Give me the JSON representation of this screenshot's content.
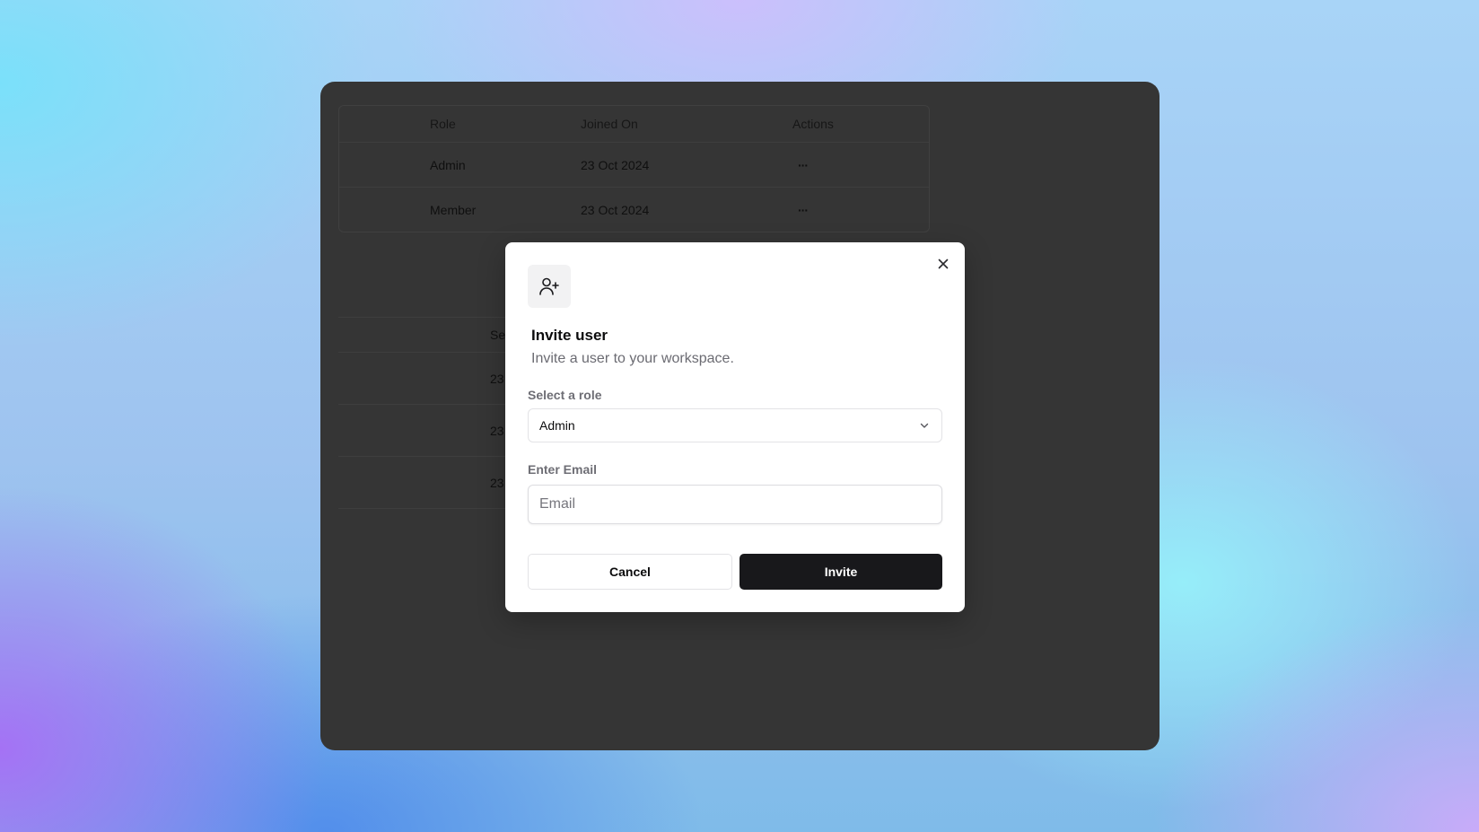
{
  "background_table": {
    "headers": {
      "role": "Role",
      "joined": "Joined On",
      "actions": "Actions"
    },
    "rows": [
      {
        "role": "Admin",
        "joined": "23 Oct 2024",
        "actions": "···"
      },
      {
        "role": "Member",
        "joined": "23 Oct 2024",
        "actions": "···"
      }
    ]
  },
  "background_table2": {
    "header": "Se",
    "rows": [
      "23",
      "23",
      "23"
    ]
  },
  "dialog": {
    "icon": "user-plus-icon",
    "title": "Invite user",
    "subtitle": "Invite a user to your workspace.",
    "role_label": "Select a role",
    "role_value": "Admin",
    "email_label": "Enter Email",
    "email_placeholder": "Email",
    "email_value": "",
    "cancel_label": "Cancel",
    "invite_label": "Invite"
  },
  "colors": {
    "overlay_panel": "#353535",
    "primary_button": "#18181b",
    "muted_text": "#6b6b72"
  }
}
